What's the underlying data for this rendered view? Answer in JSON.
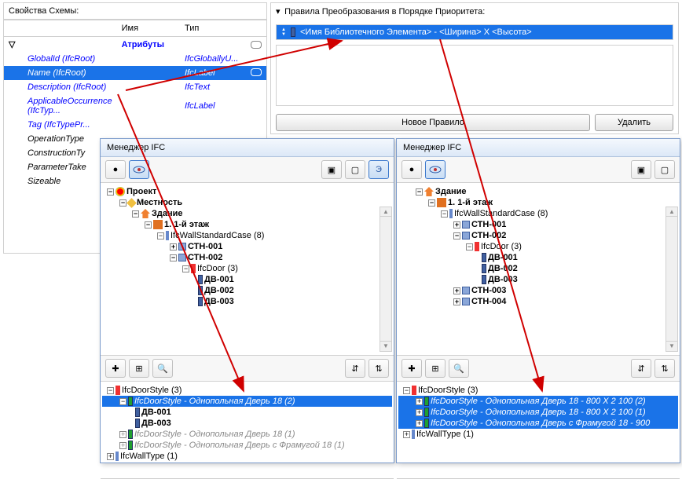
{
  "schema_panel": {
    "title": "Свойства Схемы:",
    "col_name": "Имя",
    "col_type": "Тип",
    "group": "Атрибуты",
    "rows": [
      {
        "name": "GlobalId (IfcRoot)",
        "type": "IfcGloballyU..."
      },
      {
        "name": "Name (IfcRoot)",
        "type": "IfcLabel",
        "selected": true,
        "link": true
      },
      {
        "name": "Description (IfcRoot)",
        "type": "IfcText"
      },
      {
        "name": "ApplicableOccurrence (IfcTyp...",
        "type": "IfcLabel"
      },
      {
        "name": "Tag (IfcTypePr...",
        "type": ""
      },
      {
        "name": "OperationType",
        "type": "",
        "plain": true
      },
      {
        "name": "ConstructionTy",
        "type": "",
        "plain": true
      },
      {
        "name": "ParameterTake",
        "type": "",
        "plain": true
      },
      {
        "name": "Sizeable",
        "type": "",
        "plain": true
      }
    ]
  },
  "rules_panel": {
    "title": "Правила Преобразования в Порядке Приоритета:",
    "rule_text": "<Имя Библиотечного Элемента> - <Ширина> X <Высота>",
    "btn_new": "Новое Правило",
    "btn_del": "Удалить"
  },
  "left_win": {
    "title": "Менеджер IFC",
    "tree": {
      "project": "Проект",
      "site": "Местность",
      "building": "Здание",
      "storey": "1. 1-й этаж",
      "walls": "IfcWallStandardCase (8)",
      "w1": "СТН-001",
      "w2": "СТН-002",
      "doors": "IfcDoor (3)",
      "d1": "ДВ-001",
      "d2": "ДВ-002",
      "d3": "ДВ-003"
    },
    "lower": {
      "style": "IfcDoorStyle (3)",
      "s1": "IfcDoorStyle - Однопольная Дверь 18 (2)",
      "s1d1": "ДВ-001",
      "s1d2": "ДВ-003",
      "s2": "IfcDoorStyle - Однопольная Дверь 18 (1)",
      "s3": "IfcDoorStyle - Однопольная Дверь с Фрамугой 18 (1)",
      "wt": "IfcWallType (1)"
    }
  },
  "right_win": {
    "title": "Менеджер IFC",
    "tree": {
      "building": "Здание",
      "storey": "1. 1-й этаж",
      "walls": "IfcWallStandardCase (8)",
      "w1": "СТН-001",
      "w2": "СТН-002",
      "doors": "IfcDoor (3)",
      "d1": "ДВ-001",
      "d2": "ДВ-002",
      "d3": "ДВ-003",
      "w3": "СТН-003",
      "w4": "СТН-004"
    },
    "lower": {
      "style": "IfcDoorStyle (3)",
      "s1": "IfcDoorStyle - Однопольная Дверь 18 - 800 X 2 100 (2)",
      "s2": "IfcDoorStyle - Однопольная Дверь 18 - 800 X 2 100 (1)",
      "s3": "IfcDoorStyle - Однопольная Дверь с Фрамугой 18 - 900",
      "wt": "IfcWallType (1)"
    }
  }
}
